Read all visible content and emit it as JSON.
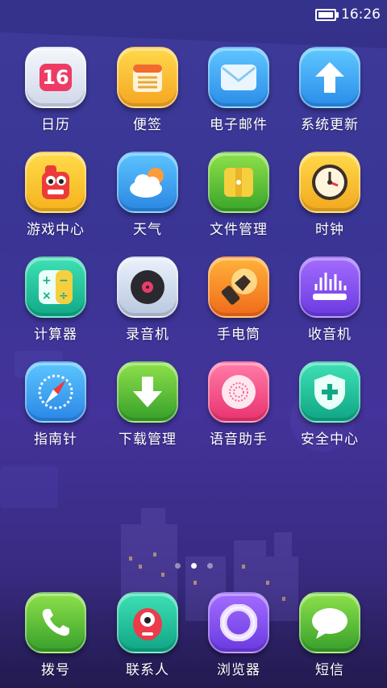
{
  "status_bar": {
    "time": "16:26",
    "battery_icon": "battery-icon"
  },
  "apps": [
    {
      "label": "日历",
      "icon": "calendar-icon",
      "badge": "16"
    },
    {
      "label": "便签",
      "icon": "notes-icon"
    },
    {
      "label": "电子邮件",
      "icon": "email-icon"
    },
    {
      "label": "系统更新",
      "icon": "system-update-icon"
    },
    {
      "label": "游戏中心",
      "icon": "game-center-icon"
    },
    {
      "label": "天气",
      "icon": "weather-icon"
    },
    {
      "label": "文件管理",
      "icon": "file-manager-icon"
    },
    {
      "label": "时钟",
      "icon": "clock-icon"
    },
    {
      "label": "计算器",
      "icon": "calculator-icon"
    },
    {
      "label": "录音机",
      "icon": "recorder-icon"
    },
    {
      "label": "手电筒",
      "icon": "flashlight-icon"
    },
    {
      "label": "收音机",
      "icon": "radio-icon"
    },
    {
      "label": "指南针",
      "icon": "compass-icon"
    },
    {
      "label": "下载管理",
      "icon": "download-manager-icon"
    },
    {
      "label": "语音助手",
      "icon": "voice-assistant-icon"
    },
    {
      "label": "安全中心",
      "icon": "security-center-icon"
    }
  ],
  "page_indicator": {
    "count": 3,
    "active": 1
  },
  "dock": [
    {
      "label": "拨号",
      "icon": "phone-icon"
    },
    {
      "label": "联系人",
      "icon": "contacts-icon"
    },
    {
      "label": "浏览器",
      "icon": "browser-icon"
    },
    {
      "label": "短信",
      "icon": "messages-icon"
    }
  ]
}
